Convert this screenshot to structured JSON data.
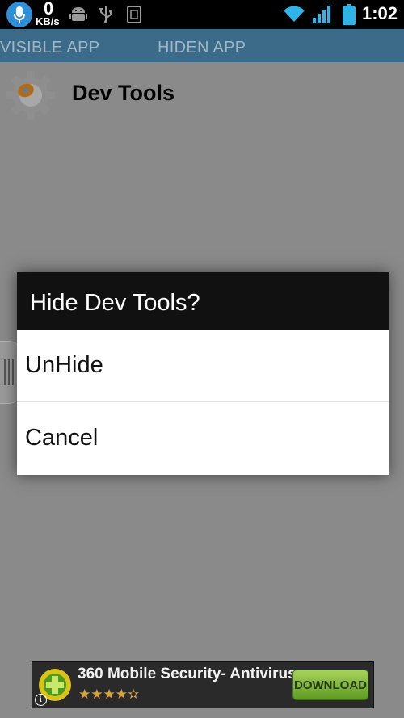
{
  "status_bar": {
    "speed_value": "0",
    "speed_unit": "KB/s",
    "time": "1:02",
    "icons": [
      "microphone-icon",
      "android-icon",
      "usb-icon",
      "sim-icon",
      "wifi-icon",
      "signal-icon",
      "battery-icon"
    ]
  },
  "tabs": [
    {
      "label": "VISIBLE APP"
    },
    {
      "label": "HIDEN APP"
    }
  ],
  "apps": [
    {
      "name": "Dev Tools",
      "icon": "gear-icon"
    }
  ],
  "dialog": {
    "title": "Hide Dev Tools?",
    "options": [
      {
        "label": "UnHide"
      },
      {
        "label": "Cancel"
      }
    ]
  },
  "ad": {
    "title": "360 Mobile Security- Antivirus",
    "rating": "★★★★✫",
    "button_label": "DOWNLOAD",
    "info_label": "i",
    "colors": {
      "button": "#8cc63f",
      "stars": "#d8a33a"
    }
  },
  "colors": {
    "overlay": "#8a8a8a",
    "tabbar": "#3b6b88",
    "dialog_title_bg": "#111111",
    "dialog_body_bg": "#ffffff"
  }
}
